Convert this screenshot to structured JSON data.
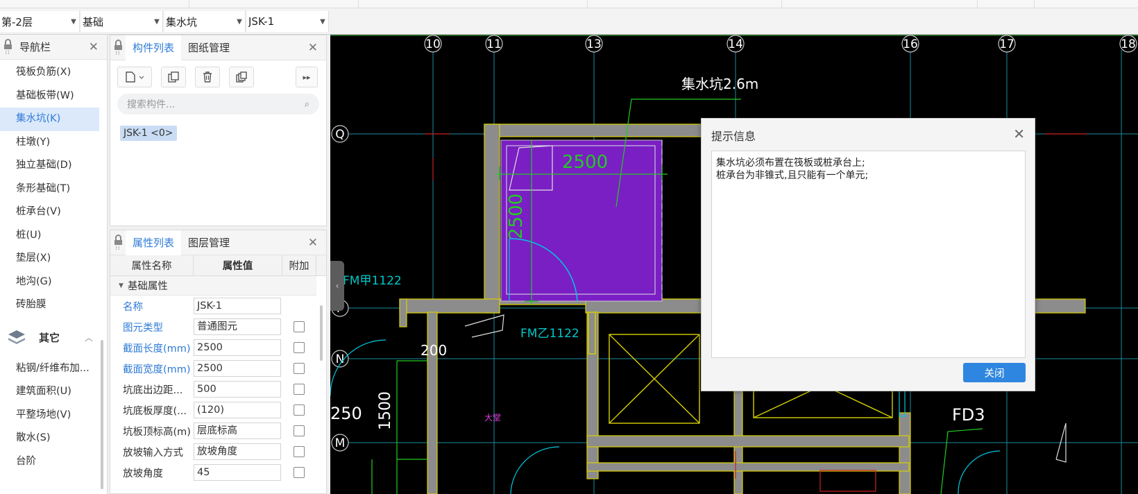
{
  "selectors": {
    "floor": "第-2层",
    "category": "基础",
    "type": "集水坑",
    "component": "JSK-1"
  },
  "nav": {
    "title": "导航栏",
    "items": [
      {
        "label": "筏板负筋(X)"
      },
      {
        "label": "基础板带(W)"
      },
      {
        "label": "集水坑(K)"
      },
      {
        "label": "柱墩(Y)"
      },
      {
        "label": "独立基础(D)"
      },
      {
        "label": "条形基础(T)"
      },
      {
        "label": "桩承台(V)"
      },
      {
        "label": "桩(U)"
      },
      {
        "label": "垫层(X)"
      },
      {
        "label": "地沟(G)"
      },
      {
        "label": "砖胎膜"
      }
    ],
    "group": {
      "label": "其它"
    },
    "group_items": [
      {
        "label": "粘钢/纤维布加..."
      },
      {
        "label": "建筑面积(U)"
      },
      {
        "label": "平整场地(V)"
      },
      {
        "label": "散水(S)"
      },
      {
        "label": "台阶"
      }
    ]
  },
  "component_panel": {
    "tab_active": "构件列表",
    "tab_other": "图纸管理",
    "search_placeholder": "搜索构件...",
    "items": [
      "JSK-1 <0>"
    ]
  },
  "property_panel": {
    "tab_active": "属性列表",
    "tab_other": "图层管理",
    "columns": [
      "属性名称",
      "属性值",
      "附加"
    ],
    "group": "基础属性",
    "rows": [
      {
        "name": "名称",
        "value": "JSK-1",
        "blue": true,
        "checkbox": false
      },
      {
        "name": "图元类型",
        "value": "普通图元",
        "blue": true,
        "checkbox": true
      },
      {
        "name": "截面长度(mm)",
        "value": "2500",
        "blue": true,
        "checkbox": true
      },
      {
        "name": "截面宽度(mm)",
        "value": "2500",
        "blue": true,
        "checkbox": true
      },
      {
        "name": "坑底出边距...",
        "value": "500",
        "blue": false,
        "checkbox": true
      },
      {
        "name": "坑底板厚度(...",
        "value": "(120)",
        "blue": false,
        "checkbox": true
      },
      {
        "name": "坑板顶标高(m)",
        "value": "层底标高",
        "blue": false,
        "checkbox": true
      },
      {
        "name": "放坡输入方式",
        "value": "放坡角度",
        "blue": false,
        "checkbox": true
      },
      {
        "name": "放坡角度",
        "value": "45",
        "blue": false,
        "checkbox": true
      }
    ]
  },
  "canvas": {
    "axis_columns": [
      "10",
      "11",
      "13",
      "14",
      "16",
      "17",
      "18"
    ],
    "axis_rows": [
      "Q",
      "P",
      "N",
      "M"
    ],
    "labels": {
      "pit_note": "集水坑2.6m",
      "dim_h": "2500",
      "dim_v": "2500",
      "door_left": "FM甲1122",
      "door_bottom": "FM乙1122",
      "dim_200": "200",
      "dim_1500": "1500",
      "dim_250": "250",
      "room_fd3": "FD3",
      "room_lobby": "大堂"
    }
  },
  "dialog": {
    "title": "提示信息",
    "lines": [
      "集水坑必须布置在筏板或桩承台上;",
      "桩承台为非锥式,且只能有一个单元;"
    ],
    "close_label": "关闭"
  },
  "colors": {
    "accent": "#2f7bd6",
    "pit_fill": "#7a1fc4",
    "wall": "#8c8c8c",
    "wall_edge": "#d8d000",
    "axis_line": "#1a8fa0",
    "dim_green": "#22cc22",
    "door_cyan": "#00c8e0"
  }
}
